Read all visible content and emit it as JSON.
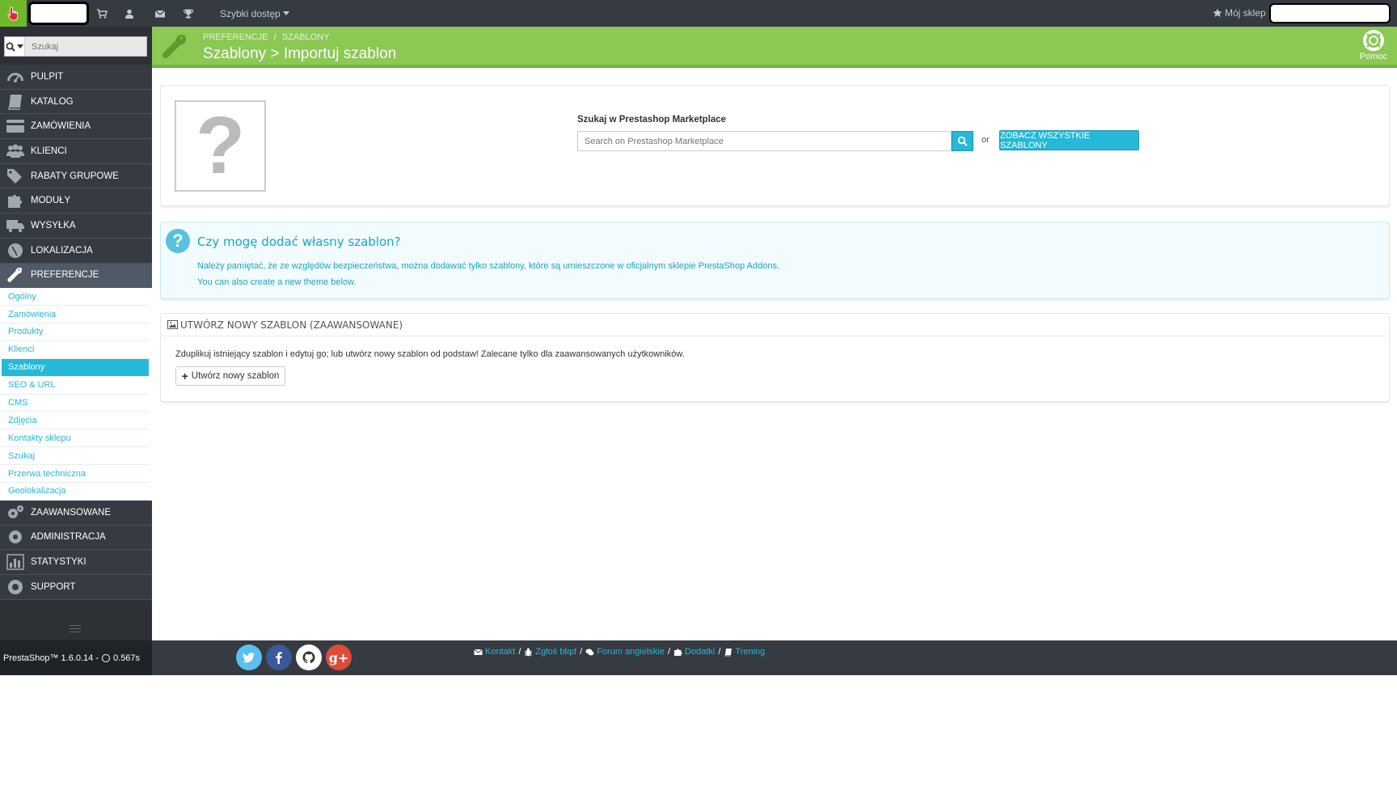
{
  "topbar": {
    "quick_access_label": "Szybki dostęp",
    "my_shop_label": "Mój sklep"
  },
  "sidebar": {
    "search_placeholder": "Szukaj",
    "menu": [
      {
        "label": "PULPIT",
        "icon": "dashboard-icon"
      },
      {
        "label": "KATALOG",
        "icon": "book-icon"
      },
      {
        "label": "ZAMÓWIENIA",
        "icon": "credit-card-icon"
      },
      {
        "label": "KLIENCI",
        "icon": "users-icon"
      },
      {
        "label": "RABATY GRUPOWE",
        "icon": "tags-icon"
      },
      {
        "label": "MODUŁY",
        "icon": "puzzle-icon"
      },
      {
        "label": "WYSYŁKA",
        "icon": "truck-icon"
      },
      {
        "label": "LOKALIZACJA",
        "icon": "globe-icon"
      },
      {
        "label": "PREFERENCJE",
        "icon": "wrench-icon"
      }
    ],
    "submenu": [
      "Ogólny",
      "Zamówienia",
      "Produkty",
      "Klienci",
      "Szablony",
      "SEO & URL",
      "CMS",
      "Zdjęcia",
      "Kontakty sklepu",
      "Szukaj",
      "Przerwa techniczna",
      "Geolokalizacja"
    ],
    "submenu_active": "Szablony",
    "menu_bottom": [
      {
        "label": "ZAAWANSOWANE",
        "icon": "cogs-icon"
      },
      {
        "label": "ADMINISTRACJA",
        "icon": "cog-icon"
      },
      {
        "label": "STATYSTYKI",
        "icon": "bar-chart-icon"
      },
      {
        "label": "SUPPORT",
        "icon": "lifebuoy-icon"
      }
    ]
  },
  "header": {
    "breadcrumb": [
      "PREFERENCJE",
      "/",
      "SZABLONY"
    ],
    "title": "Szablony > Importuj szablon",
    "help_label": "Pomoc"
  },
  "marketplace": {
    "label": "Szukaj w Prestashop Marketplace",
    "input_placeholder": "Search on Prestashop Marketplace",
    "or": "or",
    "see_all_label": "ZOBACZ WSZYSTKIE SZABLONY"
  },
  "info": {
    "title": "Czy mogę dodać własny szablon?",
    "text1": "Należy pamiętać, że ze względów bezpieczeństwa, można dodawać tylko szablony, które są umieszczone w oficjalnym sklepie PrestaShop Addons.",
    "text2": "You can also create a new theme below."
  },
  "create": {
    "heading": "UTWÓRZ NOWY SZABLON (ZAAWANSOWANE)",
    "description": "Zduplikuj istniejący szablon i edytuj go; lub utwórz nowy szablon od podstaw! Zalecane tylko dla zaawansowanych użytkowników.",
    "button_label": "Utwórz nowy szablon"
  },
  "footer": {
    "version": "PrestaShop™ 1.6.0.14 -",
    "time": "0.567s",
    "links": [
      "Kontakt",
      "Zgłoś błąd",
      "Forum angielskie",
      "Dodatki",
      "Trening"
    ]
  },
  "colors": {
    "accent": "#25b9d7",
    "header_green": "#8bc954",
    "sidebar_bg": "#363a41"
  }
}
